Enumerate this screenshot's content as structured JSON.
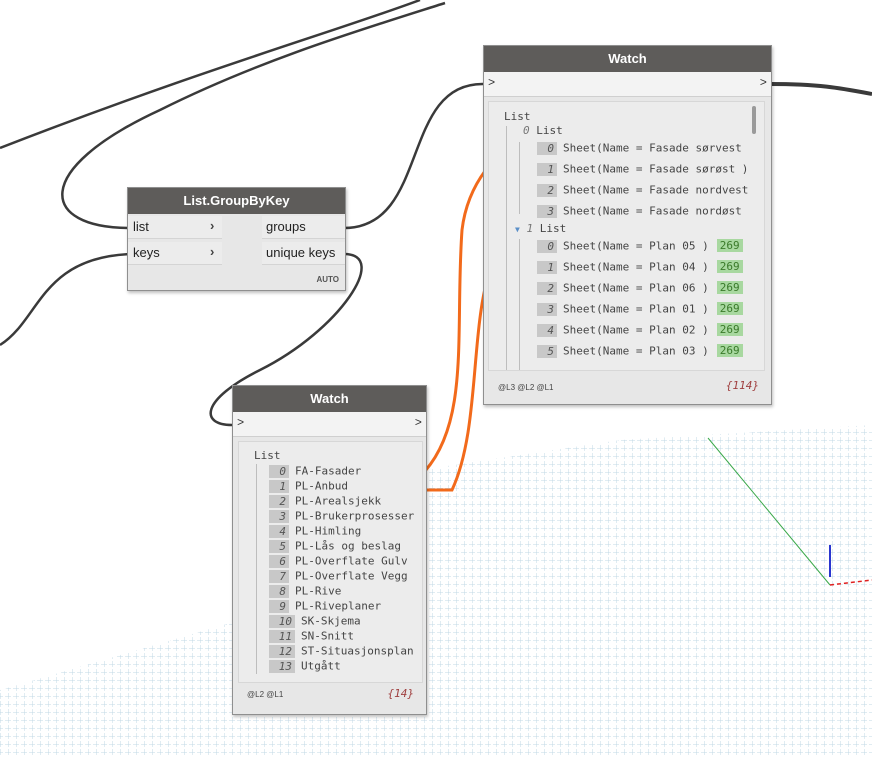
{
  "groupbykey": {
    "title": "List.GroupByKey",
    "inputs": [
      "list",
      "keys"
    ],
    "outputs": [
      "groups",
      "unique keys"
    ],
    "lacing": "AUTO"
  },
  "watch_top": {
    "title": "Watch",
    "in_port": ">",
    "out_port": ">",
    "root_label": "List",
    "sub0_index": "0",
    "sub0_label": "List",
    "sub0_items": [
      {
        "i": "0",
        "v": "Sheet(Name = Fasade sørvest"
      },
      {
        "i": "1",
        "v": "Sheet(Name = Fasade sørøst )"
      },
      {
        "i": "2",
        "v": "Sheet(Name = Fasade nordvest"
      },
      {
        "i": "3",
        "v": "Sheet(Name = Fasade nordøst"
      }
    ],
    "sub1_index": "1",
    "sub1_label": "List",
    "sub1_items": [
      {
        "i": "0",
        "v": "Sheet(Name = Plan 05 )",
        "tag": "269"
      },
      {
        "i": "1",
        "v": "Sheet(Name = Plan 04 )",
        "tag": "269"
      },
      {
        "i": "2",
        "v": "Sheet(Name = Plan 06 )",
        "tag": "269"
      },
      {
        "i": "3",
        "v": "Sheet(Name = Plan 01 )",
        "tag": "269"
      },
      {
        "i": "4",
        "v": "Sheet(Name = Plan 02 )",
        "tag": "269"
      },
      {
        "i": "5",
        "v": "Sheet(Name = Plan 03 )",
        "tag": "269"
      }
    ],
    "levels": "@L3 @L2 @L1",
    "count": "{114}"
  },
  "watch_bottom": {
    "title": "Watch",
    "in_port": ">",
    "out_port": ">",
    "root_label": "List",
    "items": [
      {
        "i": "0",
        "v": "FA-Fasader"
      },
      {
        "i": "1",
        "v": "PL-Anbud"
      },
      {
        "i": "2",
        "v": "PL-Arealsjekk"
      },
      {
        "i": "3",
        "v": "PL-Brukerprosesser"
      },
      {
        "i": "4",
        "v": "PL-Himling"
      },
      {
        "i": "5",
        "v": "PL-Lås og beslag"
      },
      {
        "i": "6",
        "v": "PL-Overflate Gulv"
      },
      {
        "i": "7",
        "v": "PL-Overflate Vegg"
      },
      {
        "i": "8",
        "v": "PL-Rive"
      },
      {
        "i": "9",
        "v": "PL-Riveplaner"
      },
      {
        "i": "10",
        "v": "SK-Skjema"
      },
      {
        "i": "11",
        "v": "SN-Snitt"
      },
      {
        "i": "12",
        "v": "ST-Situasjonsplan"
      },
      {
        "i": "13",
        "v": "Utgått"
      }
    ],
    "levels": "@L2 @L1",
    "count": "{14}"
  },
  "colors": {
    "wire": "#3a3a3a",
    "annotation": "#f26a1b",
    "node_header": "#5e5c5a",
    "grid": "#a9c9dc"
  }
}
